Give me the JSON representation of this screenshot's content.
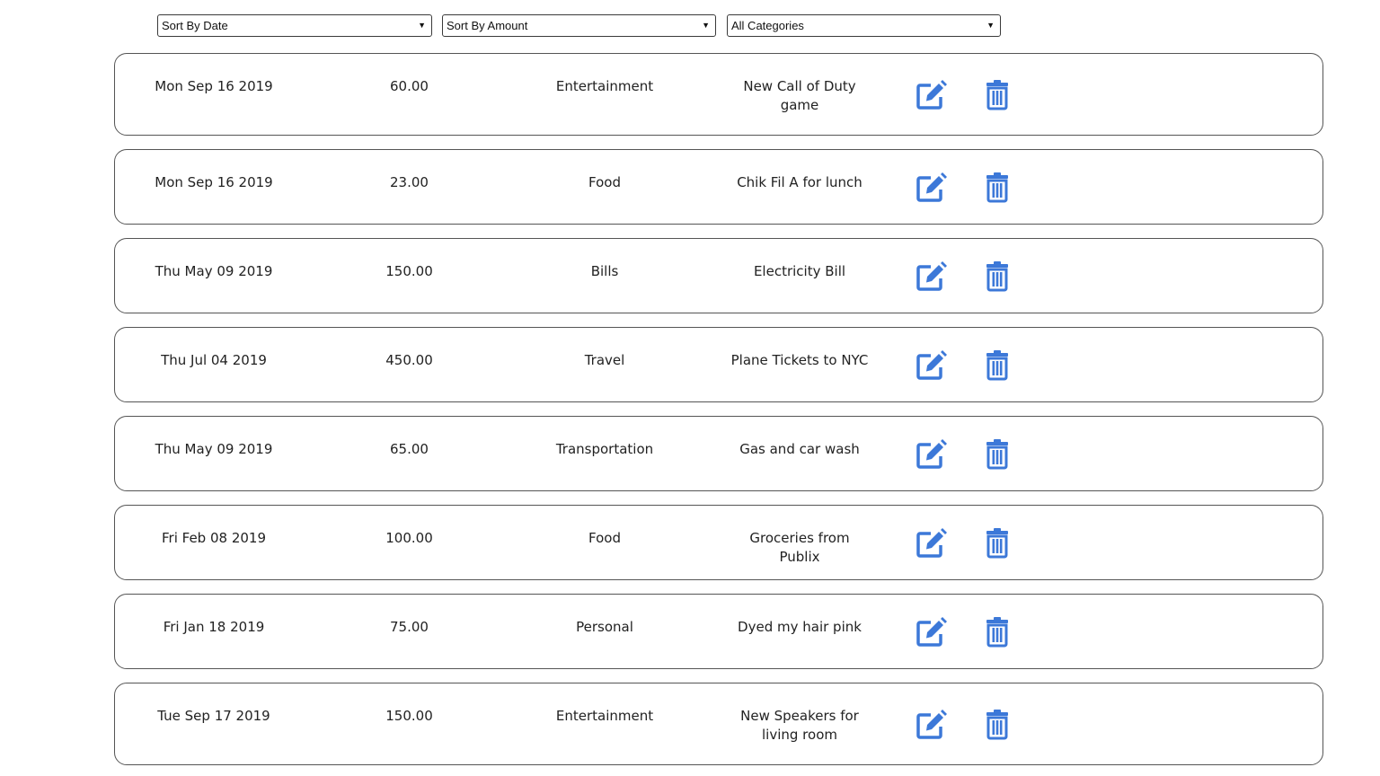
{
  "filters": {
    "sort_date": "Sort By Date",
    "sort_amount": "Sort By Amount",
    "category": "All Categories"
  },
  "colors": {
    "accent": "#3c78d8",
    "border": "#555555"
  },
  "icons": {
    "edit": "edit-icon",
    "delete": "trash-icon"
  },
  "expenses": [
    {
      "date": "Mon Sep 16 2019",
      "amount": "60.00",
      "category": "Entertainment",
      "description": "New Call of Duty game"
    },
    {
      "date": "Mon Sep 16 2019",
      "amount": "23.00",
      "category": "Food",
      "description": "Chik Fil A for lunch"
    },
    {
      "date": "Thu May 09 2019",
      "amount": "150.00",
      "category": "Bills",
      "description": "Electricity Bill"
    },
    {
      "date": "Thu Jul 04 2019",
      "amount": "450.00",
      "category": "Travel",
      "description": "Plane Tickets to NYC"
    },
    {
      "date": "Thu May 09 2019",
      "amount": "65.00",
      "category": "Transportation",
      "description": "Gas and car wash"
    },
    {
      "date": "Fri Feb 08 2019",
      "amount": "100.00",
      "category": "Food",
      "description": "Groceries from Publix"
    },
    {
      "date": "Fri Jan 18 2019",
      "amount": "75.00",
      "category": "Personal",
      "description": "Dyed my hair pink"
    },
    {
      "date": "Tue Sep 17 2019",
      "amount": "150.00",
      "category": "Entertainment",
      "description": "New Speakers for living room"
    }
  ]
}
